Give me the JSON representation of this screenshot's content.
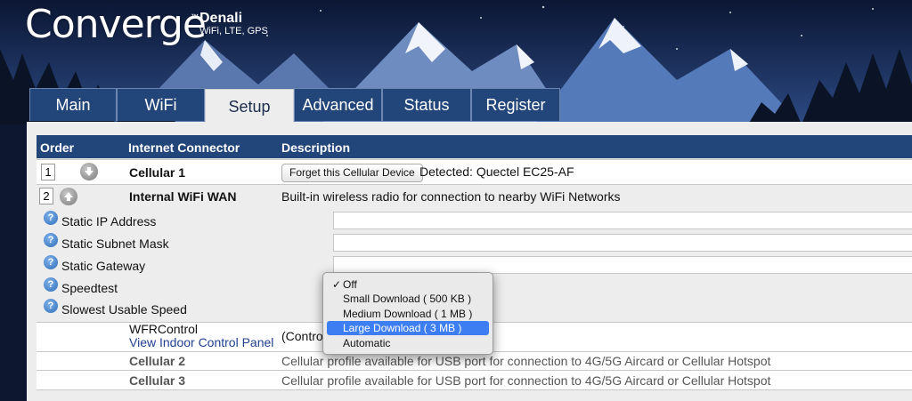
{
  "brand": {
    "name": "Converge",
    "tm": "™",
    "model": "Denali",
    "subtitle": "WiFi, LTE, GPS"
  },
  "tabs": [
    {
      "label": "Main"
    },
    {
      "label": "WiFi"
    },
    {
      "label": "Setup",
      "active": true
    },
    {
      "label": "Advanced"
    },
    {
      "label": "Status"
    },
    {
      "label": "Register"
    }
  ],
  "table_headers": {
    "order": "Order",
    "connector": "Internet Connector",
    "description": "Description"
  },
  "connectors": [
    {
      "order": "1",
      "name": "Cellular 1",
      "button": "Forget this Cellular Device",
      "description": "Detected: Quectel EC25-AF"
    },
    {
      "order": "2",
      "name": "Internal WiFi WAN",
      "description": "Built-in wireless radio for connection to nearby WiFi Networks"
    }
  ],
  "fields": [
    {
      "label": "Static IP Address",
      "value": ""
    },
    {
      "label": "Static Subnet Mask",
      "value": ""
    },
    {
      "label": "Static Gateway",
      "value": ""
    },
    {
      "label": "Speedtest"
    },
    {
      "label": "Slowest Usable Speed"
    }
  ],
  "wfr": {
    "name": "WFRControl",
    "link": "View Indoor Control Panel",
    "description": "(Control"
  },
  "other_rows": [
    {
      "name": "Cellular 2",
      "description": "Cellular profile available for USB port for connection to 4G/5G Aircard or Cellular Hotspot"
    },
    {
      "name": "Cellular 3",
      "description": "Cellular profile available for USB port for connection to 4G/5G Aircard or Cellular Hotspot"
    }
  ],
  "speedtest_dropdown": {
    "checked": "Off",
    "highlighted": "Large Download ( 3 MB )",
    "options": [
      "Off",
      "Small Download ( 500 KB )",
      "Medium Download ( 1 MB )",
      "Large Download ( 3 MB )",
      "Automatic"
    ]
  },
  "icons": {
    "help": "help-icon",
    "down": "arrow-down-icon",
    "up": "arrow-up-icon",
    "check": "checkmark-icon"
  },
  "colors": {
    "header_bg": "#22457a",
    "tab_bg": "#22457a",
    "panel_bg": "#ededed",
    "highlight": "#3d7ff2"
  }
}
